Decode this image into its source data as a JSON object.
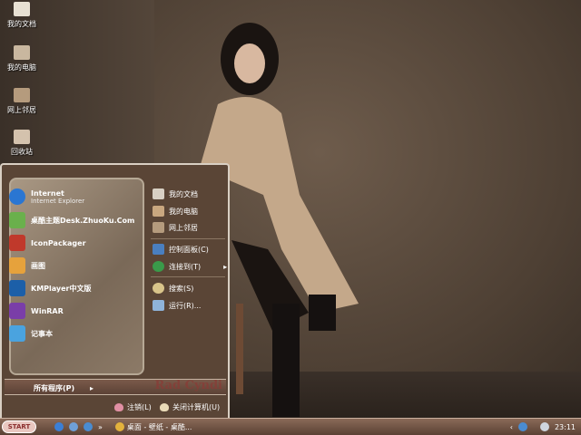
{
  "desktop_icons": [
    {
      "label": "我的文档"
    },
    {
      "label": "我的电脑"
    },
    {
      "label": "网上邻居"
    },
    {
      "label": "回收站"
    }
  ],
  "start_menu": {
    "programs": [
      {
        "label": "Internet",
        "sub": "Internet Explorer",
        "icon": "ie-icon",
        "color": "#2a76d2"
      },
      {
        "label": "桌酷主题Desk.ZhuoKu.Com",
        "icon": "zhuoku-icon",
        "color": "#6ab04c"
      },
      {
        "label": "IconPackager",
        "icon": "iconpackager-icon",
        "color": "#c0392b"
      },
      {
        "label": "画图",
        "icon": "paint-icon",
        "color": "#e6a23c"
      },
      {
        "label": "KMPlayer中文版",
        "icon": "kmplayer-icon",
        "color": "#1c5fa8"
      },
      {
        "label": "WinRAR",
        "icon": "winrar-icon",
        "color": "#7a3ea8"
      },
      {
        "label": "记事本",
        "icon": "notepad-icon",
        "color": "#4aa3df"
      }
    ],
    "places": [
      {
        "label": "我的文档",
        "icon": "documents-icon"
      },
      {
        "label": "我的电脑",
        "icon": "computer-icon"
      },
      {
        "label": "网上邻居",
        "icon": "network-icon"
      },
      {
        "label": "控制面板(C)",
        "icon": "control-panel-icon"
      },
      {
        "label": "连接到(T)",
        "icon": "connect-icon",
        "arrow": "▸"
      },
      {
        "label": "搜索(S)",
        "icon": "search-icon"
      },
      {
        "label": "运行(R)...",
        "icon": "run-icon"
      }
    ],
    "all_programs": "所有程序(P)",
    "all_programs_arrow": "▸",
    "brand": "Rad Cyndi",
    "logoff": "注销(L)",
    "shutdown": "关闭计算机(U)"
  },
  "taskbar": {
    "start": "START",
    "task": "桌面 - 壁纸 - 桌酷...",
    "chevron": "»",
    "clock": "23:11"
  }
}
